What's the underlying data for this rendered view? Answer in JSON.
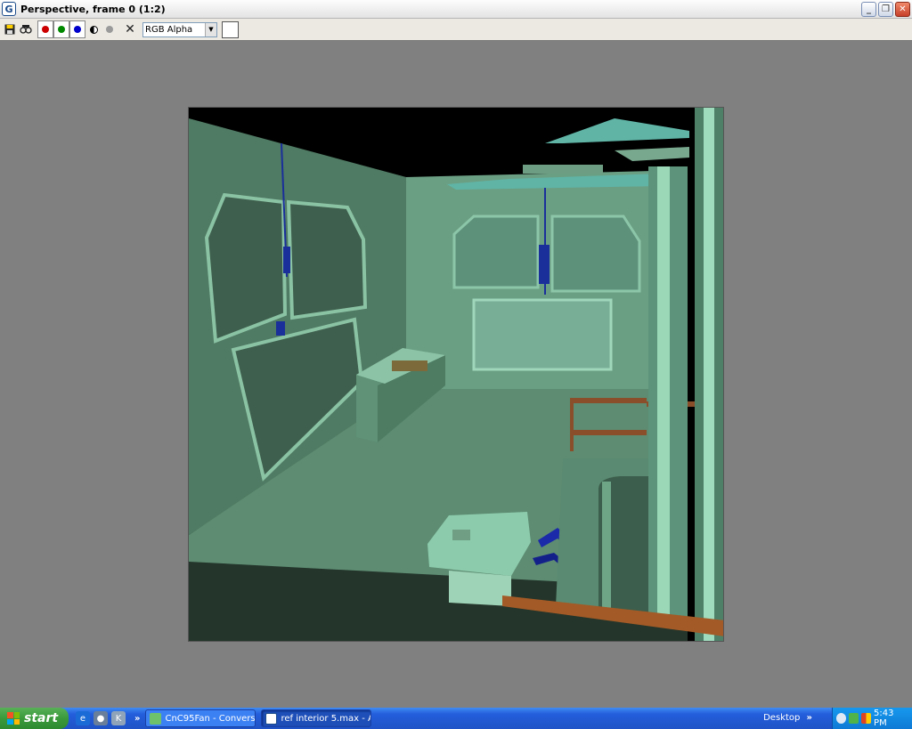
{
  "window": {
    "title": "Perspective, frame 0 (1:2)",
    "app_icon": "3ds-max-logo-icon",
    "app_icon_glyph": "G",
    "minimize_label": "_",
    "restore_label": "❐",
    "close_label": "✕"
  },
  "toolbar": {
    "save_icon": "save-icon",
    "clone_icon": "clone-icon",
    "channels": [
      {
        "name": "red-channel",
        "color": "#cc0000"
      },
      {
        "name": "green-channel",
        "color": "#008800"
      },
      {
        "name": "blue-channel",
        "color": "#0000cc"
      }
    ],
    "channel_select": "RGB Alpha",
    "clear_label": "✕"
  },
  "taskbar": {
    "start_label": "start",
    "quick_launch": [
      "ie-icon",
      "media-icon",
      "max-icon"
    ],
    "quick_launch_more": "»",
    "tasks": [
      {
        "label": "CnC95Fan - Convers...",
        "active": false
      },
      {
        "label": "ref interior 5.max - A...",
        "active": true
      }
    ],
    "desktop_label": "Desktop",
    "desktop_more": "»",
    "clock": "5:43 PM"
  }
}
